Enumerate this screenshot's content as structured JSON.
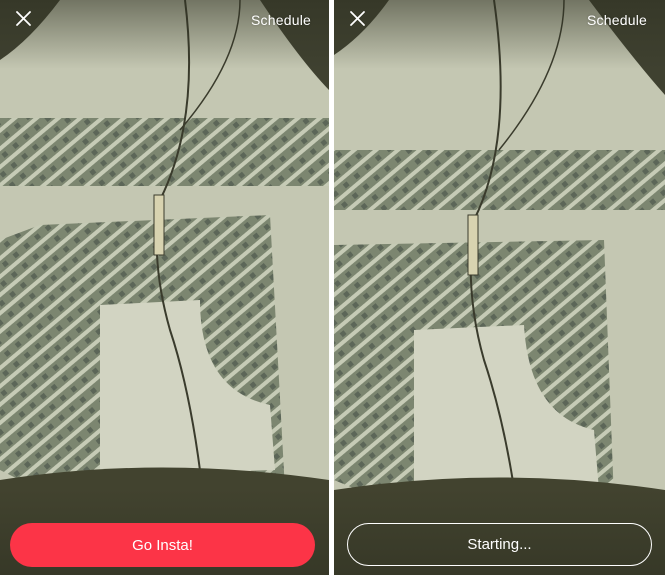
{
  "screens": [
    {
      "id": "ready",
      "close_icon": "close-icon",
      "schedule_label": "Schedule",
      "action_label": "Go Insta!"
    },
    {
      "id": "starting",
      "close_icon": "close-icon",
      "schedule_label": "Schedule",
      "action_label": "Starting..."
    }
  ],
  "colors": {
    "accent": "#fc3447",
    "divider": "#ffffff",
    "overlay_text": "#ffffff"
  }
}
